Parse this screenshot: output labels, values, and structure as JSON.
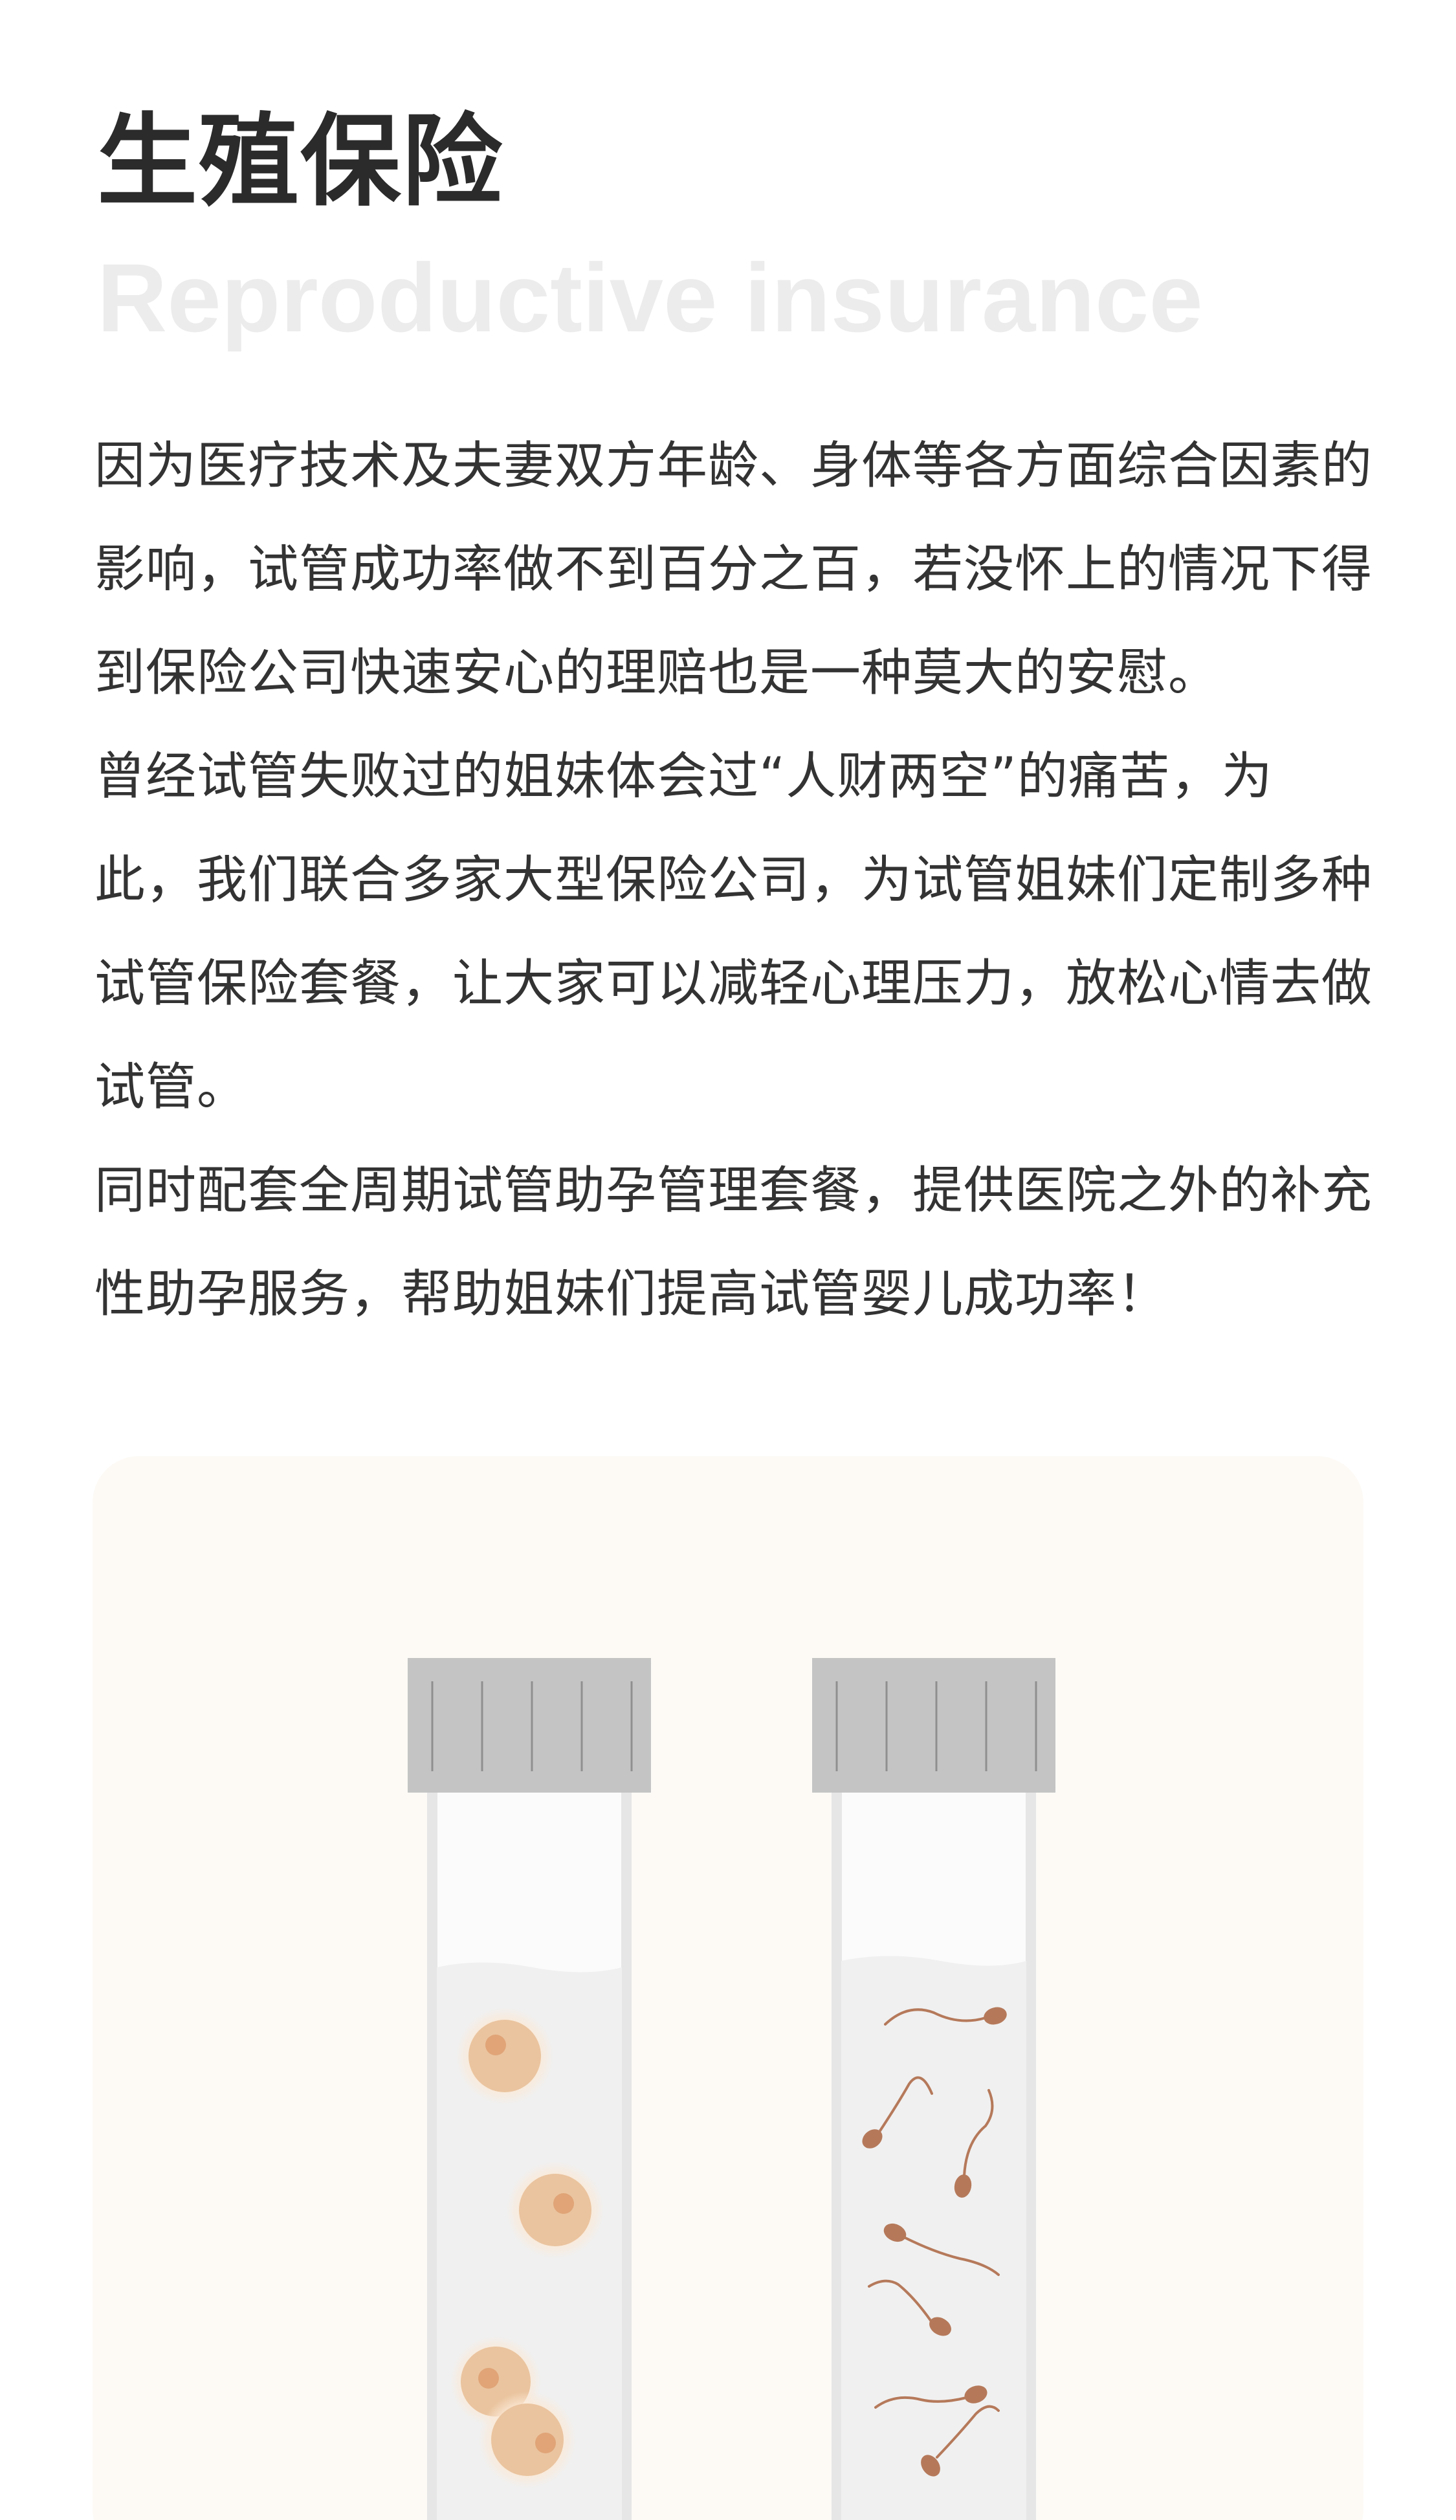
{
  "page": {
    "title": "生殖保险",
    "subtitle": "Reproductive insurance"
  },
  "intro": {
    "paragraphs": [
      "因为医疗技术及夫妻双方年龄、身体等各方面综合因素的影响，试管成功率做不到百分之百，若没怀上的情况下得到保险公司快速安心的理赔也是一种莫大的安慰。",
      "曾经试管失败过的姐妹体会过“人财两空”的痛苦，为此，我们联合多家大型保险公司，为试管姐妹们定制多种试管保险套餐，让大家可以减轻心理压力，放松心情去做试管。",
      "同时配套全周期试管助孕管理套餐，提供医院之外的补充性助孕服务，帮助姐妹们提高试管婴儿成功率！"
    ]
  },
  "illustration": {
    "left_tube_content": "egg-cells",
    "right_tube_content": "sperm-cells",
    "colors": {
      "card_background": "#fdfaf6",
      "cap": "#c4c4c4",
      "tube_outline": "#e6e6e6",
      "liquid": "#f0f0f0",
      "egg": "#eac49f",
      "egg_nucleus": "#e0a477",
      "sperm": "#b5795a"
    }
  }
}
